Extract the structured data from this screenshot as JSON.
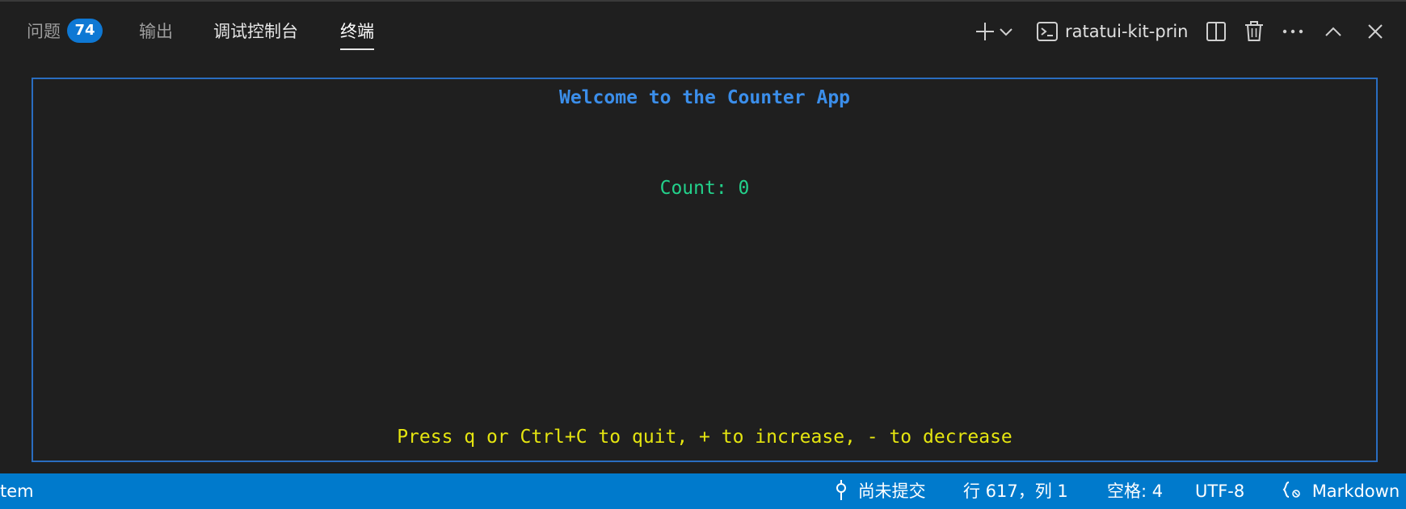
{
  "tabs": [
    {
      "label": "问题",
      "badge": "74"
    },
    {
      "label": "输出"
    },
    {
      "label": "调试控制台"
    },
    {
      "label": "终端",
      "active": true
    }
  ],
  "toolbar": {
    "new_terminal_icon": "plus-icon",
    "dropdown_icon": "chevron-down-icon",
    "terminal_icon": "terminal-icon",
    "terminal_name": "ratatui-kit-prin",
    "split_icon": "split-icon",
    "trash_icon": "trash-icon",
    "more_icon": "ellipsis-icon",
    "maximize_icon": "chevron-up-icon",
    "close_icon": "close-icon"
  },
  "terminal": {
    "welcome": "Welcome to the Counter App",
    "count": "Count: 0",
    "help": "Press q or Ctrl+C to quit, + to increase, - to decrease",
    "border_color": "#2a6dc0",
    "welcome_color": "#3b8eea",
    "count_color": "#23d18b",
    "help_color": "#e5e510"
  },
  "statusbar": {
    "left_text": "tem",
    "git": "尚未提交",
    "position": "行 617，列 1",
    "spaces": "空格: 4",
    "encoding": "UTF-8",
    "language": "Markdown",
    "background": "#007acc"
  }
}
